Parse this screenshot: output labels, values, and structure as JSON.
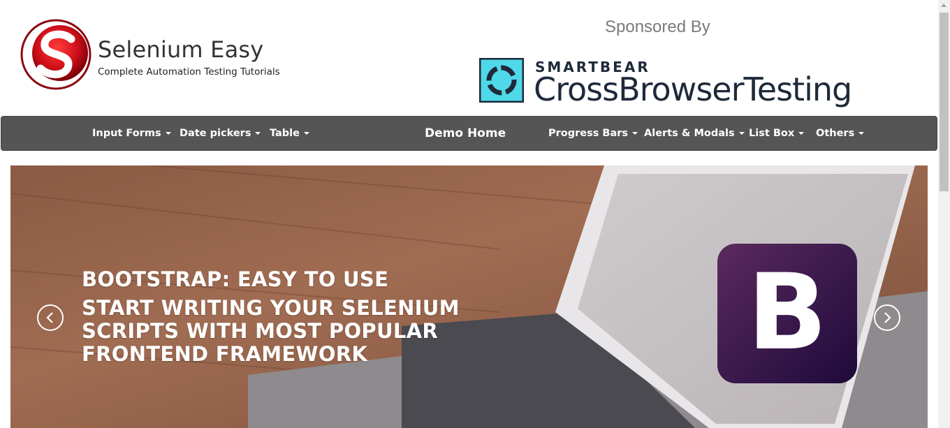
{
  "header": {
    "brand_title": "Selenium Easy",
    "brand_subtitle": "Complete Automation Testing Tutorials",
    "sponsored_label": "Sponsored By",
    "sponsor_small": "SMARTBEAR",
    "sponsor_large": "CrossBrowserTesting"
  },
  "nav": {
    "left_items": [
      {
        "label": "Input Forms"
      },
      {
        "label": "Date pickers"
      },
      {
        "label": "Table"
      }
    ],
    "home": "Demo Home",
    "right_items": [
      {
        "label": "Progress Bars"
      },
      {
        "label": "Alerts & Modals"
      },
      {
        "label": "List Box"
      },
      {
        "label": "Others"
      }
    ]
  },
  "carousel": {
    "title": "BOOTSTRAP: EASY TO USE",
    "text": "START WRITING YOUR SELENIUM SCRIPTS WITH MOST POPULAR FRONTEND FRAMEWORK",
    "logo_letter": "B"
  },
  "colors": {
    "navbar": "#555555",
    "brand_red": "#c8102e",
    "sponsor_teal": "#4fd8e8",
    "bootstrap_purple": "#563d7c"
  },
  "icons": {
    "prev": "chevron-left-icon",
    "next": "chevron-right-icon"
  }
}
